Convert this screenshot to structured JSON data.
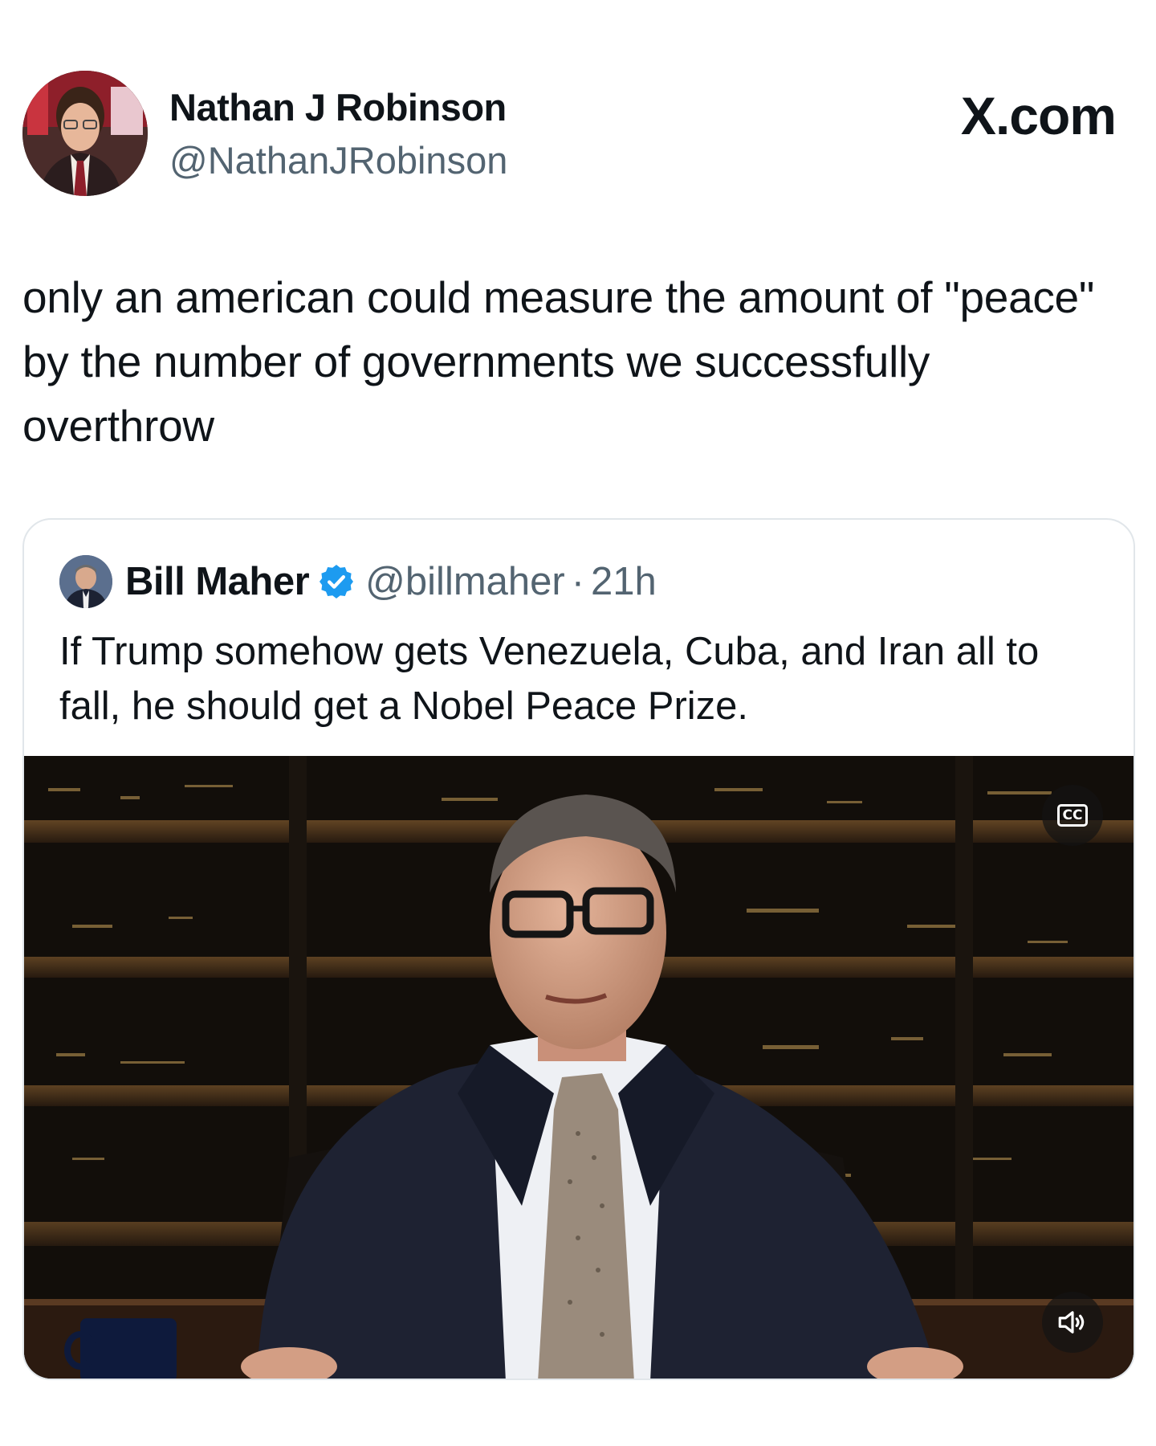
{
  "post": {
    "author_name": "Nathan J Robinson",
    "author_handle": "@NathanJRobinson",
    "brand": "X.com",
    "text": "only an american could measure the amount of \"peace\" by the number of governments we successfully overthrow"
  },
  "quoted": {
    "name": "Bill Maher",
    "handle": "@billmaher",
    "separator": "·",
    "time": "21h",
    "text": "If Trump somehow gets Venezuela, Cuba, and Iran all to fall, he should get a Nobel Peace Prize.",
    "verified_color": "#1d9bf0"
  },
  "video": {
    "cc_label": "CC",
    "mute_icon": "speaker-icon"
  }
}
